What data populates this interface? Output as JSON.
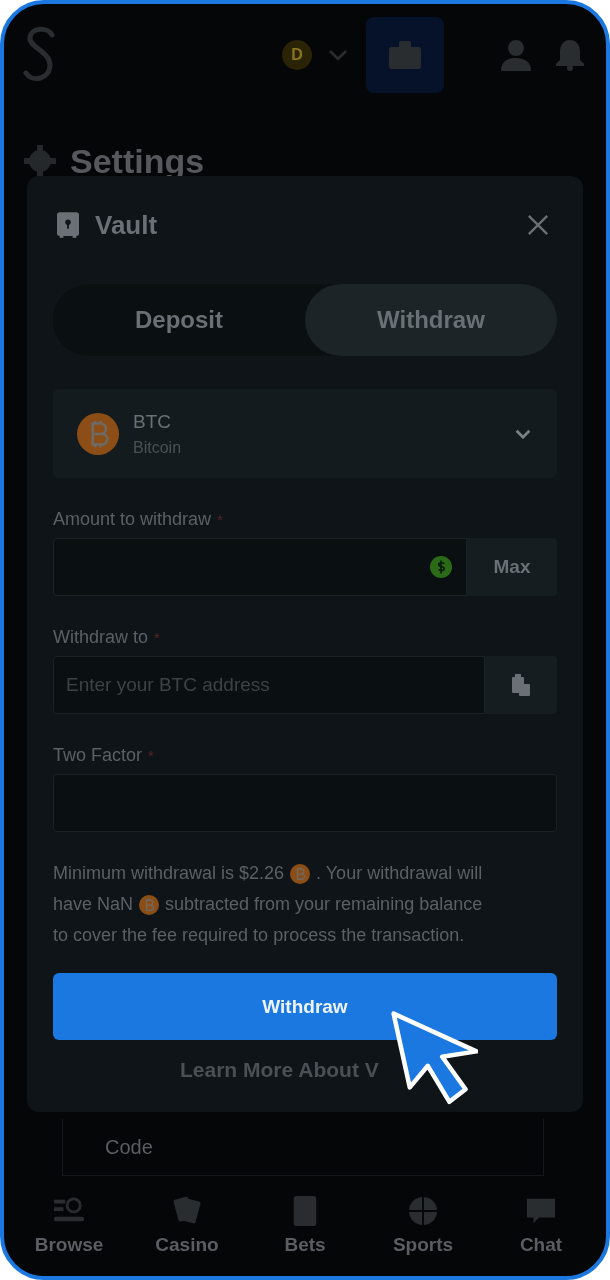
{
  "header": {
    "balance_coin": "D",
    "wallet_selected": true
  },
  "background": {
    "title": "Settings",
    "field_label": "Code"
  },
  "modal": {
    "title": "Vault",
    "tabs": [
      {
        "label": "Deposit",
        "selected": false
      },
      {
        "label": "Withdraw",
        "selected": true
      }
    ],
    "currency": {
      "code": "BTC",
      "name": "Bitcoin"
    },
    "fields": [
      {
        "kind": "amount",
        "label": "Amount to withdraw",
        "required_mark": "*",
        "button": "Max"
      },
      {
        "kind": "address",
        "label": "Withdraw to",
        "required_mark": "*",
        "placeholder": "Enter your BTC address"
      },
      {
        "kind": "plain",
        "label": "Two Factor",
        "required_mark": "*"
      }
    ],
    "notice": [
      [
        {
          "kind": "text",
          "text": "Minimum withdrawal is $2.26"
        },
        {
          "kind": "coin"
        },
        {
          "kind": "text",
          "text": ". Your withdrawal will"
        }
      ],
      [
        {
          "kind": "text",
          "text": "have NaN"
        },
        {
          "kind": "coin"
        },
        {
          "kind": "text",
          "text": "subtracted from your remaining balance"
        }
      ],
      [
        {
          "kind": "text",
          "text": "to cover the fee required to process the transaction."
        }
      ]
    ],
    "submit": "Withdraw",
    "link": "Learn More About V"
  },
  "nav": [
    {
      "label": "Browse"
    },
    {
      "label": "Casino"
    },
    {
      "label": "Bets"
    },
    {
      "label": "Sports"
    },
    {
      "label": "Chat"
    }
  ]
}
